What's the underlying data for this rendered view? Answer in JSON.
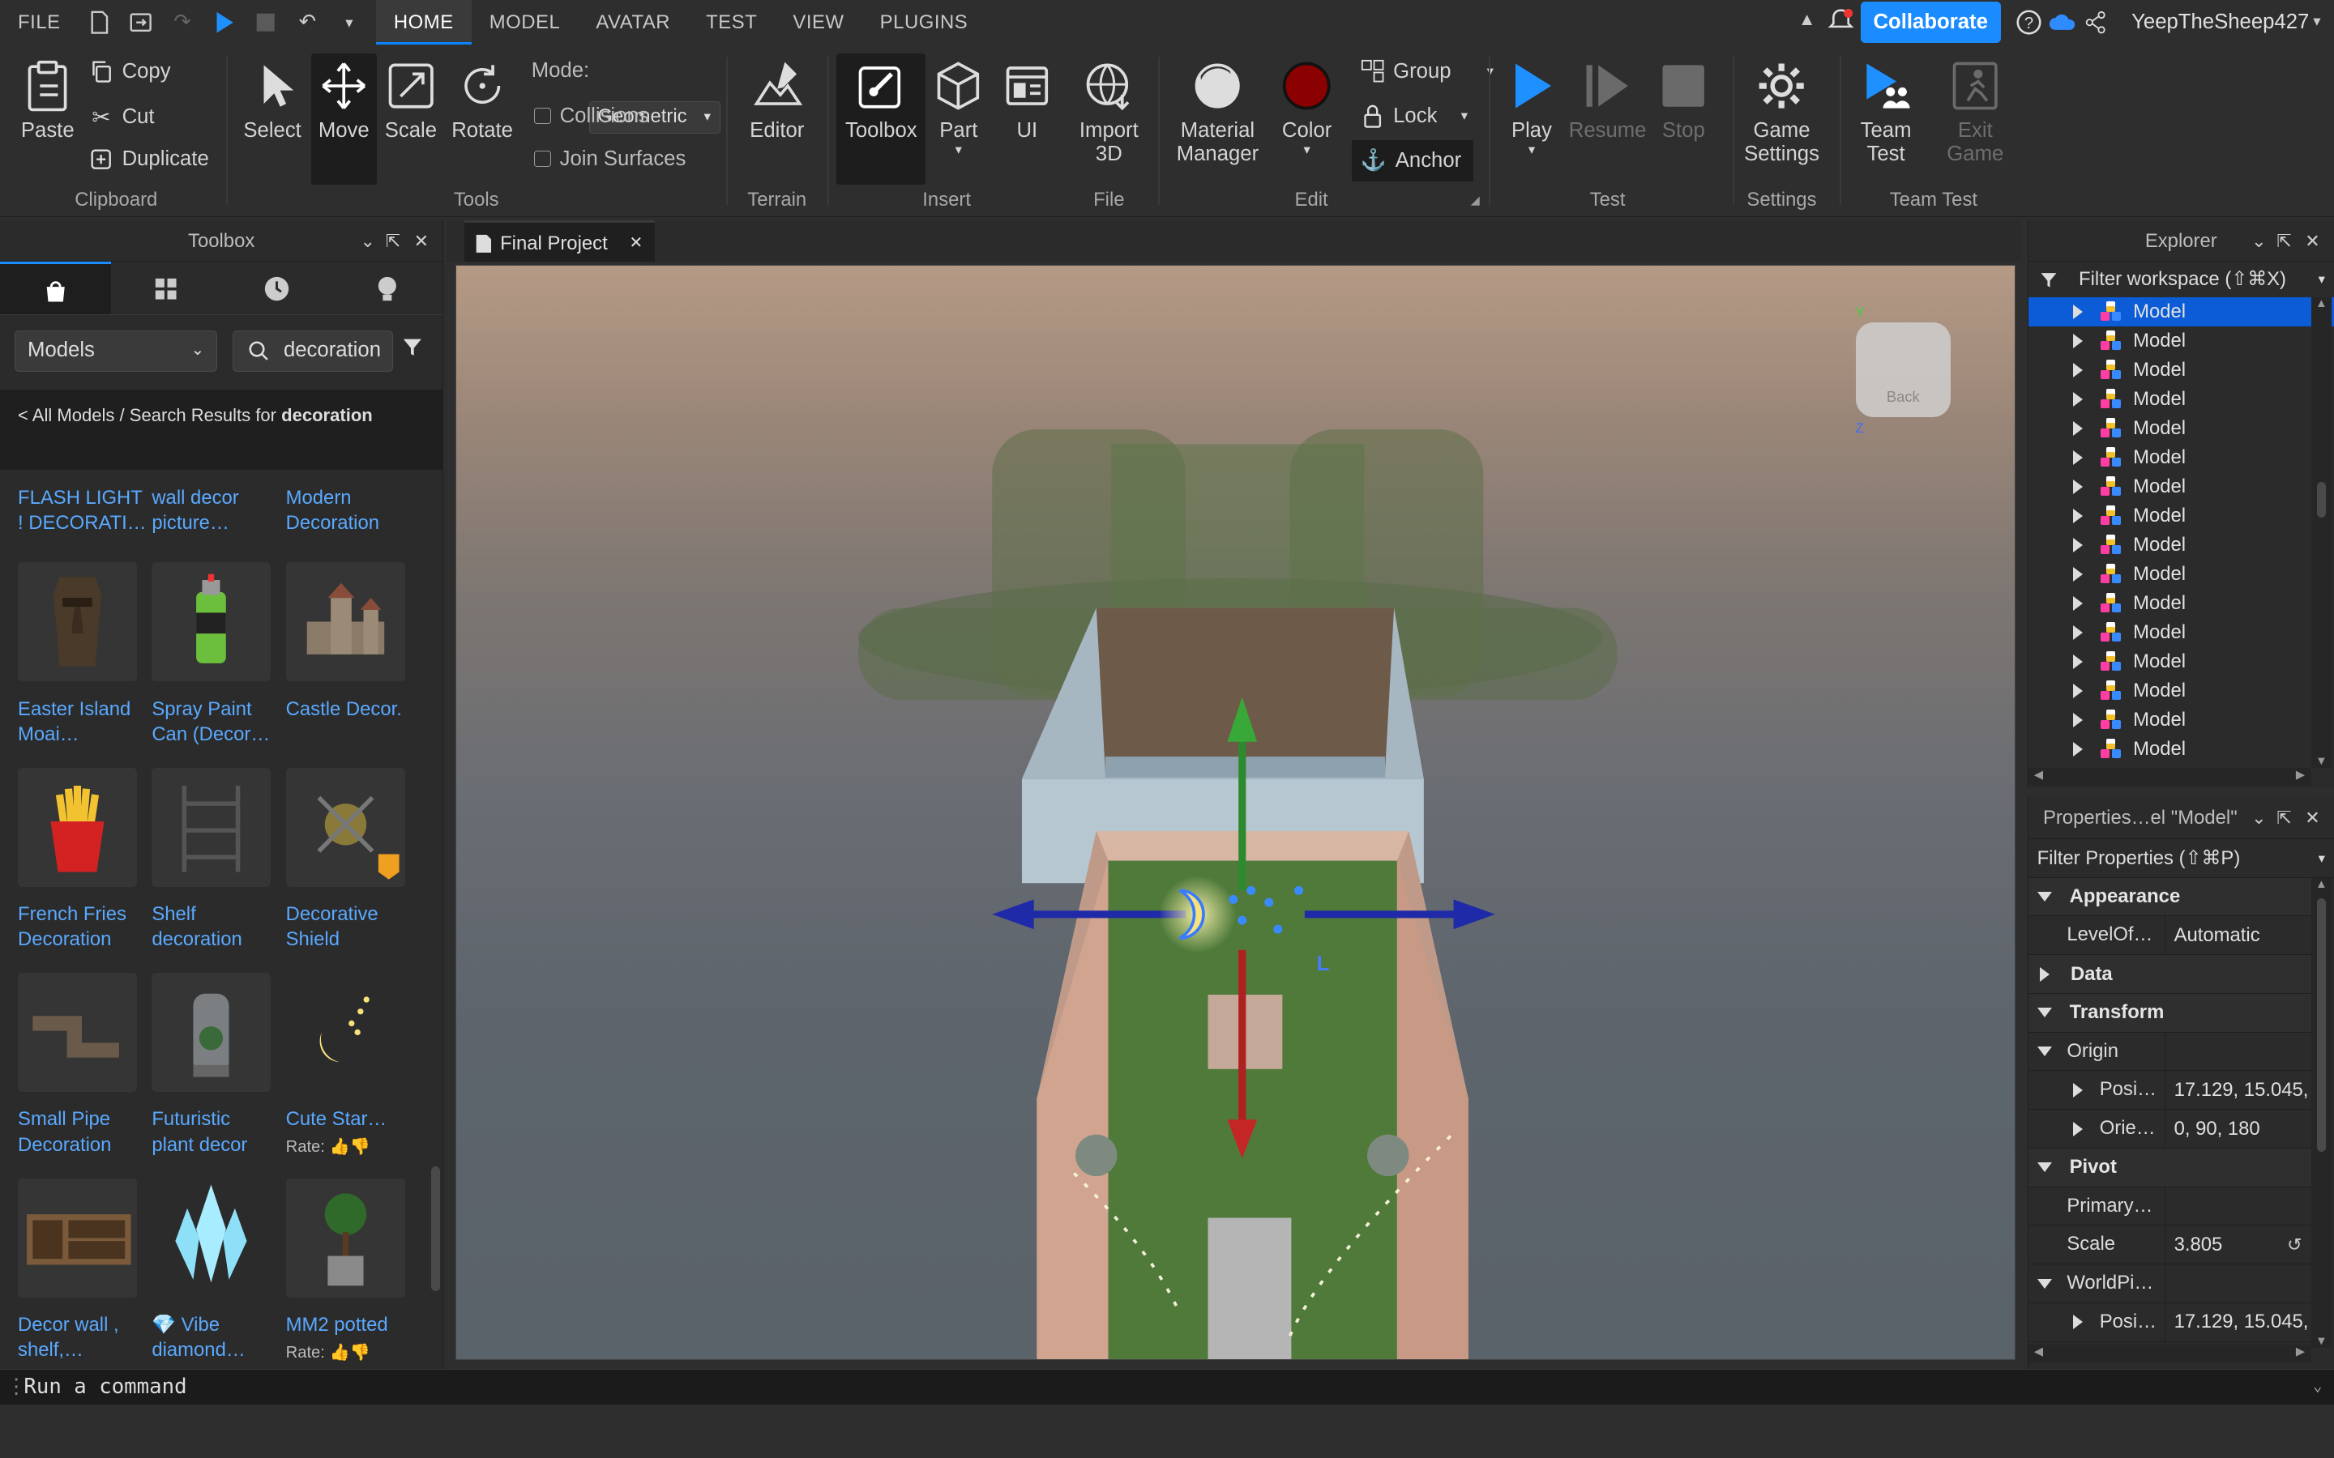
{
  "menubar": {
    "file": "FILE",
    "tabs": [
      "HOME",
      "MODEL",
      "AVATAR",
      "TEST",
      "VIEW",
      "PLUGINS"
    ],
    "active_tab": "HOME",
    "collaborate": "Collaborate",
    "username": "YeepTheSheep427"
  },
  "ribbon": {
    "clipboard": {
      "paste": "Paste",
      "copy": "Copy",
      "cut": "Cut",
      "duplicate": "Duplicate",
      "label": "Clipboard"
    },
    "tools": {
      "select": "Select",
      "move": "Move",
      "scale": "Scale",
      "rotate": "Rotate",
      "mode_label": "Mode:",
      "mode_value": "Geometric",
      "collisions": "Collisions",
      "join_surfaces": "Join Surfaces",
      "label": "Tools"
    },
    "terrain": {
      "editor": "Editor",
      "label": "Terrain"
    },
    "insert": {
      "toolbox": "Toolbox",
      "part": "Part",
      "ui": "UI",
      "label": "Insert"
    },
    "file": {
      "import_line1": "Import",
      "import_line2": "3D",
      "label": "File"
    },
    "edit": {
      "material_line1": "Material",
      "material_line2": "Manager",
      "color": "Color",
      "group": "Group",
      "lock": "Lock",
      "anchor": "Anchor",
      "label": "Edit"
    },
    "test": {
      "play": "Play",
      "resume": "Resume",
      "stop": "Stop",
      "label": "Test"
    },
    "settings": {
      "game_line1": "Game",
      "game_line2": "Settings",
      "label": "Settings"
    },
    "team_test": {
      "team_line1": "Team",
      "team_line2": "Test",
      "exit_line1": "Exit",
      "exit_line2": "Game",
      "label": "Team Test"
    }
  },
  "toolbox": {
    "title": "Toolbox",
    "category": "Models",
    "search_value": "decoration",
    "breadcrumb_prefix": "< All Models / Search Results for ",
    "breadcrumb_term": "decoration",
    "items": [
      {
        "line1": "FLASH LIGHT",
        "line2": "! DECORATI…"
      },
      {
        "line1": "wall decor",
        "line2": "picture…"
      },
      {
        "line1": "Modern",
        "line2": "Decoration"
      },
      {
        "line1": "Easter Island",
        "line2": "Moai…"
      },
      {
        "line1": "Spray Paint",
        "line2": "Can (Decor…"
      },
      {
        "line1": "Castle Decor.",
        "line2": ""
      },
      {
        "line1": "French Fries",
        "line2": "Decoration"
      },
      {
        "line1": "Shelf",
        "line2": "decoration"
      },
      {
        "line1": "Decorative",
        "line2": "Shield"
      },
      {
        "line1": "Small Pipe",
        "line2": "Decoration"
      },
      {
        "line1": "Futuristic",
        "line2": "plant decor"
      },
      {
        "line1": "Cute Star…",
        "line2": ""
      },
      {
        "line1": "Decor wall ,",
        "line2": "shelf,…"
      },
      {
        "line1": "💎 Vibe",
        "line2": "diamond…"
      },
      {
        "line1": "MM2 potted",
        "line2": ""
      }
    ],
    "rate_label": "Rate:"
  },
  "document": {
    "tab_name": "Final Project"
  },
  "viewcube": {
    "face": "Back",
    "axis_y": "Y",
    "axis_z": "Z"
  },
  "viewport": {
    "selection_label": "L"
  },
  "explorer": {
    "title": "Explorer",
    "filter": "Filter workspace (⇧⌘X)",
    "items": [
      "Model",
      "Model",
      "Model",
      "Model",
      "Model",
      "Model",
      "Model",
      "Model",
      "Model",
      "Model",
      "Model",
      "Model",
      "Model",
      "Model",
      "Model",
      "Model"
    ]
  },
  "properties": {
    "title": "Properties…el \"Model\"",
    "filter": "Filter Properties (⇧⌘P)",
    "rows": [
      {
        "kind": "cat",
        "open": true,
        "name": "Appearance"
      },
      {
        "kind": "prop",
        "name": "LevelOf…",
        "value": "Automatic"
      },
      {
        "kind": "cat",
        "open": false,
        "name": "Data"
      },
      {
        "kind": "cat",
        "open": true,
        "name": "Transform"
      },
      {
        "kind": "sub",
        "name": "Origin",
        "value": ""
      },
      {
        "kind": "subprop",
        "name": "Posi…",
        "value": "17.129, 15.045,"
      },
      {
        "kind": "subprop",
        "name": "Orie…",
        "value": "0, 90, 180"
      },
      {
        "kind": "cat",
        "open": true,
        "name": "Pivot"
      },
      {
        "kind": "prop",
        "name": "Primary…",
        "value": ""
      },
      {
        "kind": "prop",
        "name": "Scale",
        "value": "3.805"
      },
      {
        "kind": "sub",
        "name": "WorldPi…",
        "value": ""
      },
      {
        "kind": "subprop",
        "name": "Posi…",
        "value": "17.129, 15.045,"
      }
    ]
  },
  "command_bar": {
    "placeholder": "Run a command"
  },
  "colors": {
    "accent": "#0a84ff",
    "selection": "#0b5cd6",
    "link": "#5aa9ff"
  }
}
